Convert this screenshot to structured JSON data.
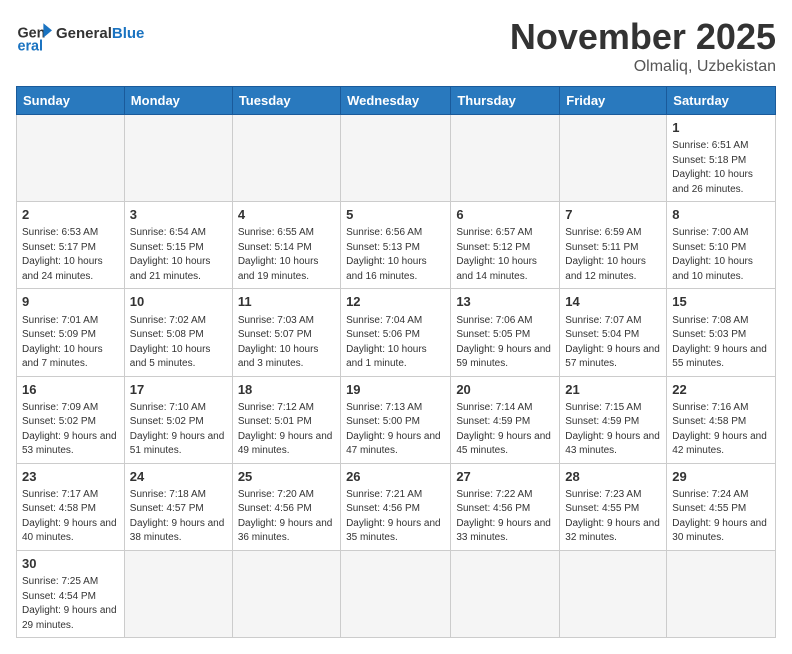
{
  "header": {
    "logo_general": "General",
    "logo_blue": "Blue",
    "month": "November 2025",
    "location": "Olmaliq, Uzbekistan"
  },
  "weekdays": [
    "Sunday",
    "Monday",
    "Tuesday",
    "Wednesday",
    "Thursday",
    "Friday",
    "Saturday"
  ],
  "weeks": [
    [
      {
        "day": "",
        "info": ""
      },
      {
        "day": "",
        "info": ""
      },
      {
        "day": "",
        "info": ""
      },
      {
        "day": "",
        "info": ""
      },
      {
        "day": "",
        "info": ""
      },
      {
        "day": "",
        "info": ""
      },
      {
        "day": "1",
        "info": "Sunrise: 6:51 AM\nSunset: 5:18 PM\nDaylight: 10 hours\nand 26 minutes."
      }
    ],
    [
      {
        "day": "2",
        "info": "Sunrise: 6:53 AM\nSunset: 5:17 PM\nDaylight: 10 hours\nand 24 minutes."
      },
      {
        "day": "3",
        "info": "Sunrise: 6:54 AM\nSunset: 5:15 PM\nDaylight: 10 hours\nand 21 minutes."
      },
      {
        "day": "4",
        "info": "Sunrise: 6:55 AM\nSunset: 5:14 PM\nDaylight: 10 hours\nand 19 minutes."
      },
      {
        "day": "5",
        "info": "Sunrise: 6:56 AM\nSunset: 5:13 PM\nDaylight: 10 hours\nand 16 minutes."
      },
      {
        "day": "6",
        "info": "Sunrise: 6:57 AM\nSunset: 5:12 PM\nDaylight: 10 hours\nand 14 minutes."
      },
      {
        "day": "7",
        "info": "Sunrise: 6:59 AM\nSunset: 5:11 PM\nDaylight: 10 hours\nand 12 minutes."
      },
      {
        "day": "8",
        "info": "Sunrise: 7:00 AM\nSunset: 5:10 PM\nDaylight: 10 hours\nand 10 minutes."
      }
    ],
    [
      {
        "day": "9",
        "info": "Sunrise: 7:01 AM\nSunset: 5:09 PM\nDaylight: 10 hours\nand 7 minutes."
      },
      {
        "day": "10",
        "info": "Sunrise: 7:02 AM\nSunset: 5:08 PM\nDaylight: 10 hours\nand 5 minutes."
      },
      {
        "day": "11",
        "info": "Sunrise: 7:03 AM\nSunset: 5:07 PM\nDaylight: 10 hours\nand 3 minutes."
      },
      {
        "day": "12",
        "info": "Sunrise: 7:04 AM\nSunset: 5:06 PM\nDaylight: 10 hours\nand 1 minute."
      },
      {
        "day": "13",
        "info": "Sunrise: 7:06 AM\nSunset: 5:05 PM\nDaylight: 9 hours\nand 59 minutes."
      },
      {
        "day": "14",
        "info": "Sunrise: 7:07 AM\nSunset: 5:04 PM\nDaylight: 9 hours\nand 57 minutes."
      },
      {
        "day": "15",
        "info": "Sunrise: 7:08 AM\nSunset: 5:03 PM\nDaylight: 9 hours\nand 55 minutes."
      }
    ],
    [
      {
        "day": "16",
        "info": "Sunrise: 7:09 AM\nSunset: 5:02 PM\nDaylight: 9 hours\nand 53 minutes."
      },
      {
        "day": "17",
        "info": "Sunrise: 7:10 AM\nSunset: 5:02 PM\nDaylight: 9 hours\nand 51 minutes."
      },
      {
        "day": "18",
        "info": "Sunrise: 7:12 AM\nSunset: 5:01 PM\nDaylight: 9 hours\nand 49 minutes."
      },
      {
        "day": "19",
        "info": "Sunrise: 7:13 AM\nSunset: 5:00 PM\nDaylight: 9 hours\nand 47 minutes."
      },
      {
        "day": "20",
        "info": "Sunrise: 7:14 AM\nSunset: 4:59 PM\nDaylight: 9 hours\nand 45 minutes."
      },
      {
        "day": "21",
        "info": "Sunrise: 7:15 AM\nSunset: 4:59 PM\nDaylight: 9 hours\nand 43 minutes."
      },
      {
        "day": "22",
        "info": "Sunrise: 7:16 AM\nSunset: 4:58 PM\nDaylight: 9 hours\nand 42 minutes."
      }
    ],
    [
      {
        "day": "23",
        "info": "Sunrise: 7:17 AM\nSunset: 4:58 PM\nDaylight: 9 hours\nand 40 minutes."
      },
      {
        "day": "24",
        "info": "Sunrise: 7:18 AM\nSunset: 4:57 PM\nDaylight: 9 hours\nand 38 minutes."
      },
      {
        "day": "25",
        "info": "Sunrise: 7:20 AM\nSunset: 4:56 PM\nDaylight: 9 hours\nand 36 minutes."
      },
      {
        "day": "26",
        "info": "Sunrise: 7:21 AM\nSunset: 4:56 PM\nDaylight: 9 hours\nand 35 minutes."
      },
      {
        "day": "27",
        "info": "Sunrise: 7:22 AM\nSunset: 4:56 PM\nDaylight: 9 hours\nand 33 minutes."
      },
      {
        "day": "28",
        "info": "Sunrise: 7:23 AM\nSunset: 4:55 PM\nDaylight: 9 hours\nand 32 minutes."
      },
      {
        "day": "29",
        "info": "Sunrise: 7:24 AM\nSunset: 4:55 PM\nDaylight: 9 hours\nand 30 minutes."
      }
    ],
    [
      {
        "day": "30",
        "info": "Sunrise: 7:25 AM\nSunset: 4:54 PM\nDaylight: 9 hours\nand 29 minutes."
      },
      {
        "day": "",
        "info": ""
      },
      {
        "day": "",
        "info": ""
      },
      {
        "day": "",
        "info": ""
      },
      {
        "day": "",
        "info": ""
      },
      {
        "day": "",
        "info": ""
      },
      {
        "day": "",
        "info": ""
      }
    ]
  ]
}
